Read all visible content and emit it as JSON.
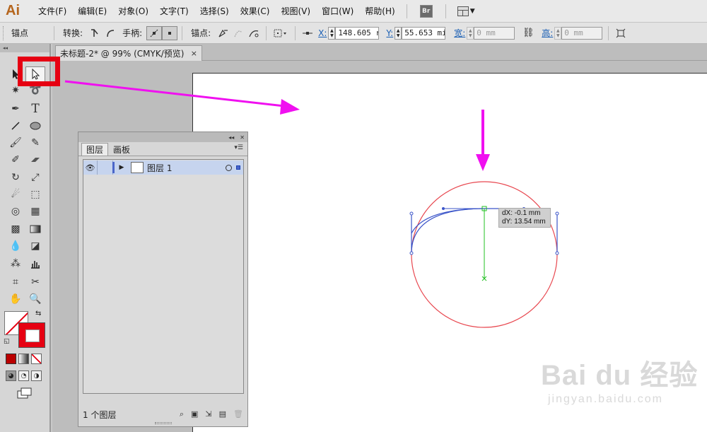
{
  "app": {
    "logo": "Ai"
  },
  "menu": {
    "items": [
      "文件(F)",
      "编辑(E)",
      "对象(O)",
      "文字(T)",
      "选择(S)",
      "效果(C)",
      "视图(V)",
      "窗口(W)",
      "帮助(H)"
    ],
    "bridge_label": "Br"
  },
  "control": {
    "anchor_label": "锚点",
    "convert_label": "转换:",
    "handle_label": "手柄:",
    "anchors_label": "锚点:",
    "x_label": "X:",
    "x_value": "148.605 r",
    "y_label": "Y:",
    "y_value": "55.653 mi",
    "width_label": "宽:",
    "width_value": "0 mm",
    "height_label": "高:",
    "height_value": "0 mm"
  },
  "document": {
    "tab_title": "未标题-2* @ 99% (CMYK/预览)",
    "close": "×"
  },
  "layers_panel": {
    "tab_layers": "图层",
    "tab_artboards": "画板",
    "layer_name": "图层 1",
    "footer_count": "1 个图层"
  },
  "canvas": {
    "tooltip_dx": "dX: -0.1 mm",
    "tooltip_dy": "dY: 13.54 mm"
  },
  "colors": {
    "highlight_red": "#e60012",
    "arrow_magenta": "#f010f0",
    "circle_stroke": "#e8474f",
    "path_blue": "#3b55c9",
    "guide_green": "#21c021"
  },
  "watermark": {
    "main": "Bai du 经验",
    "sub": "jingyan.baidu.com"
  },
  "tools": [
    "selection-tool",
    "direct-selection-tool",
    "magic-wand-tool",
    "lasso-tool",
    "pen-tool",
    "type-tool",
    "line-tool",
    "ellipse-tool",
    "paintbrush-tool",
    "pencil-tool",
    "blob-brush-tool",
    "eraser-tool",
    "rotate-tool",
    "scale-tool",
    "warp-tool",
    "free-transform-tool",
    "shape-builder-tool",
    "perspective-grid-tool",
    "mesh-tool",
    "gradient-tool",
    "eyedropper-tool",
    "blend-tool",
    "symbol-sprayer-tool",
    "graph-tool",
    "artboard-tool",
    "slice-tool",
    "hand-tool",
    "zoom-tool"
  ]
}
